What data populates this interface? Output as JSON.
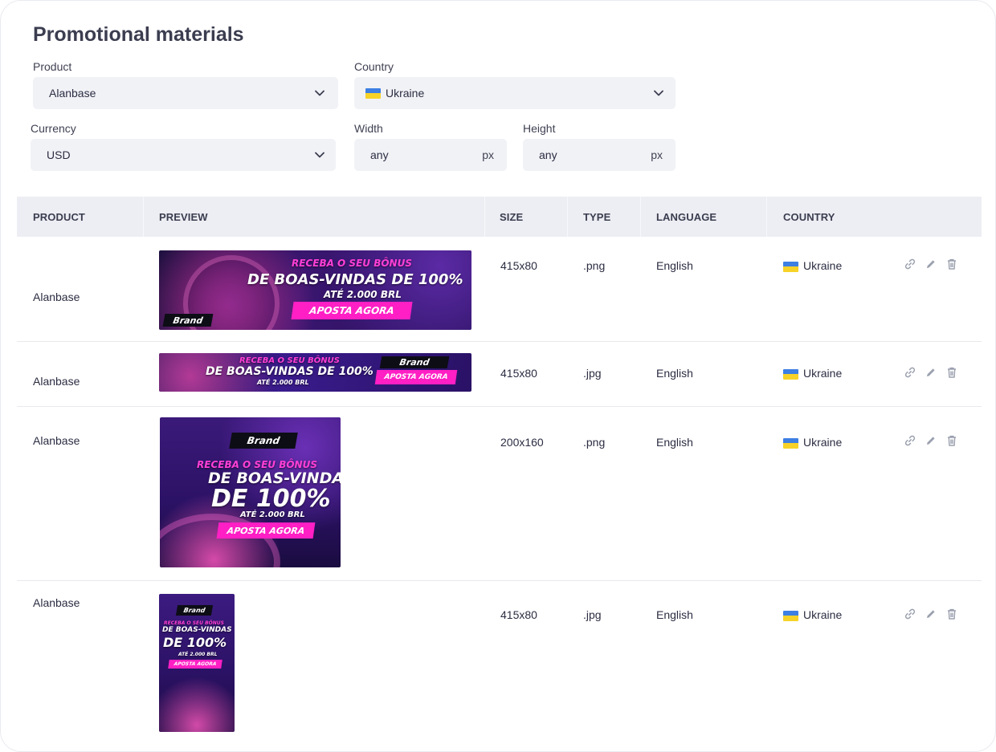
{
  "page": {
    "title": "Promotional materials"
  },
  "filters": {
    "product": {
      "label": "Product",
      "value": "Alanbase"
    },
    "country": {
      "label": "Country",
      "value": "Ukraine"
    },
    "currency": {
      "label": "Currency",
      "value": "USD"
    },
    "width": {
      "label": "Width",
      "placeholder": "any",
      "unit": "px"
    },
    "height": {
      "label": "Height",
      "placeholder": "any",
      "unit": "px"
    }
  },
  "table": {
    "columns": [
      "PRODUCT",
      "PREVIEW",
      "SIZE",
      "TYPE",
      "LANGUAGE",
      "COUNTRY"
    ],
    "rows": [
      {
        "product": "Alanbase",
        "size": "415x80",
        "type": ".png",
        "language": "English",
        "country": "Ukraine"
      },
      {
        "product": "Alanbase",
        "size": "415x80",
        "type": ".jpg",
        "language": "English",
        "country": "Ukraine"
      },
      {
        "product": "Alanbase",
        "size": "200x160",
        "type": ".png",
        "language": "English",
        "country": "Ukraine"
      },
      {
        "product": "Alanbase",
        "size": "415x80",
        "type": ".jpg",
        "language": "English",
        "country": "Ukraine"
      }
    ]
  },
  "banner_text": {
    "headline": "RECEBA O SEU BÔNUS",
    "big": "DE BOAS-VINDAS DE 100%",
    "big_line1": "DE BOAS-VINDAS",
    "big_line2": "DE 100%",
    "amount": "ATÉ 2.000 BRL",
    "cta": "APOSTA AGORA",
    "brand": "Brand"
  },
  "icons": {
    "chevron": "chevron-down-icon",
    "link": "link-icon",
    "edit": "pencil-icon",
    "delete": "trash-icon"
  },
  "colors": {
    "flag_ua_blue": "#3d7fe3",
    "flag_ua_yellow": "#f7d228",
    "header_bg": "#edeef3",
    "input_bg": "#f1f2f6",
    "banner_pink": "#ff1fc4"
  }
}
